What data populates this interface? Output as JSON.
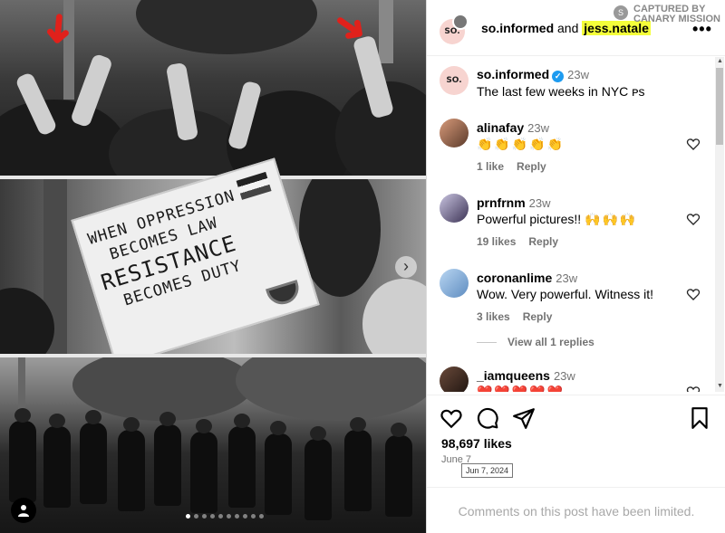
{
  "post": {
    "author": "so.informed",
    "connector": "and",
    "collaborator": "jess.natale",
    "more_label": "•••",
    "avatar_text": "SO."
  },
  "watermark": {
    "line1": "CAPTURED BY",
    "line2": "CANARY MISSION",
    "icon": "S"
  },
  "media": {
    "sign_lines": [
      "WHEN OPPRESSION",
      "BECOMES LAW",
      "RESISTANCE",
      "BECOMES DUTY"
    ],
    "next_label": "›",
    "slide_count": 10,
    "active_slide": 1
  },
  "caption": {
    "user": "so.informed",
    "time": "23w",
    "text": "The last few weeks in NYC ᴘs",
    "verified_icon": "✓"
  },
  "comments": [
    {
      "user": "alinafay",
      "time": "23w",
      "text": "👏👏👏👏👏",
      "likes": "1 like",
      "reply": "Reply",
      "text_style": "emo"
    },
    {
      "user": "prnfrnm",
      "time": "23w",
      "text": "Powerful pictures!! ",
      "emoji": "🙌🙌🙌",
      "likes": "19 likes",
      "reply": "Reply"
    },
    {
      "user": "coronanlime",
      "time": "23w",
      "text": "Wow. Very powerful. Witness it!",
      "likes": "3 likes",
      "reply": "Reply"
    },
    {
      "user": "_iamqueens",
      "time": "23w",
      "text": "❤️❤️❤️❤️❤️"
    }
  ],
  "view_replies": "View all 1 replies",
  "stats": {
    "likes": "98,697 likes",
    "date": "June 7",
    "date_tooltip": "Jun 7, 2024"
  },
  "footer": {
    "limited_text": "Comments on this post have been limited."
  },
  "icons": {
    "like": "heart-icon",
    "comment": "comment-icon",
    "share": "send-icon",
    "save": "bookmark-icon"
  },
  "colors": {
    "highlight": "#f4ff3a",
    "arrow": "#e0211b",
    "verified": "#1d9bf0"
  }
}
